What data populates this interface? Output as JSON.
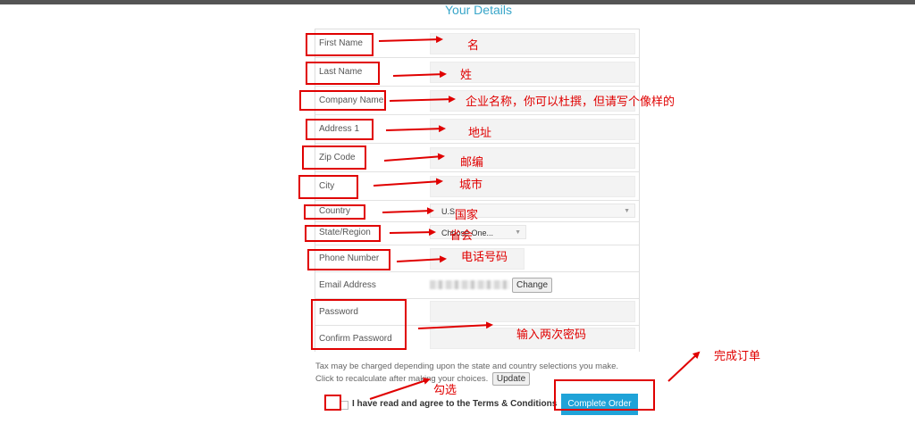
{
  "page_title": "Your Details",
  "form": {
    "first_name_label": "First Name",
    "last_name_label": "Last Name",
    "company_label": "Company Name",
    "address_label": "Address 1",
    "zip_label": "Zip Code",
    "city_label": "City",
    "country_label": "Country",
    "country_value": "U.S.",
    "state_label": "State/Region",
    "state_value": "Choose One...",
    "phone_label": "Phone Number",
    "email_label": "Email Address",
    "change_label": "Change",
    "password_label": "Password",
    "confirm_password_label": "Confirm Password"
  },
  "tax_note": {
    "line1": "Tax may be charged depending upon the state and country selections you make.",
    "line2": "Click to recalculate after making your choices.",
    "update_label": "Update"
  },
  "agree_label": "I have read and agree to the Terms & Conditions",
  "complete_order_label": "Complete Order",
  "annotations": {
    "first_name": "名",
    "last_name": "姓",
    "company": "企业名称，你可以杜撰，但请写个像样的",
    "address": "地址",
    "zip": "邮编",
    "city": "城市",
    "country": "国家",
    "state": "省会",
    "phone": "电话号码",
    "password": "输入两次密码",
    "agree": "勾选",
    "complete": "完成订单"
  },
  "colors": {
    "accent": "#1fa3d8",
    "title": "#39a6c9",
    "annotation": "#e00000"
  }
}
